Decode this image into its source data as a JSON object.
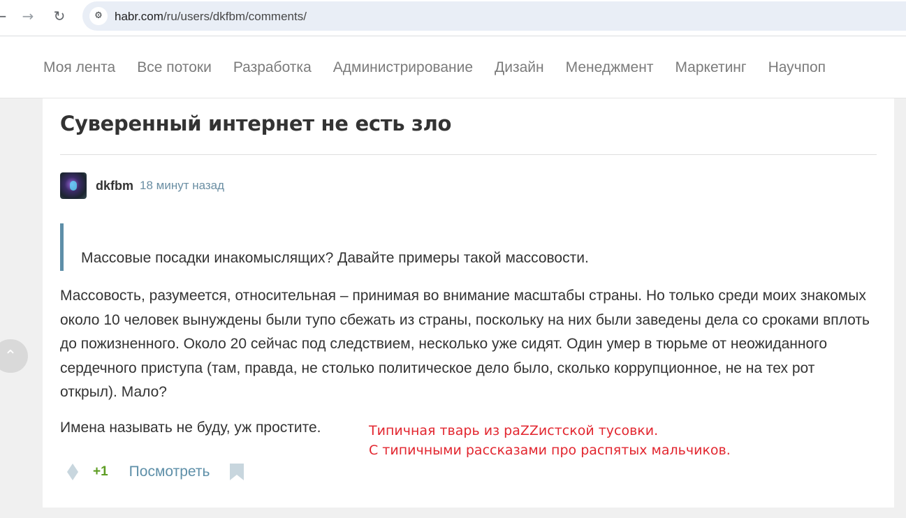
{
  "browser": {
    "back_icon": "arrow-left-icon",
    "forward_icon": "arrow-right-icon",
    "reload_icon": "reload-icon",
    "site_info_icon": "tune-icon",
    "url_host": "habr.com",
    "url_path": "/ru/users/dkfbm/comments/"
  },
  "nav": {
    "items": [
      "Моя лента",
      "Все потоки",
      "Разработка",
      "Администрирование",
      "Дизайн",
      "Менеджмент",
      "Маркетинг",
      "Научпоп"
    ]
  },
  "post": {
    "title": "Суверенный интернет не есть зло"
  },
  "comment": {
    "username": "dkfbm",
    "time": "18 минут назад",
    "quote": "Массовые посадки инакомыслящих? Давайте примеры такой массовости.",
    "paragraph1": "Массовость, разумеется, относительная – принимая во внимание масштабы страны. Но только среди моих знакомых около 10 человек вынуждены были тупо сбежать из страны, поскольку на них были заведены дела со сроками вплоть до пожизненного. Около 20 сейчас под следствием, несколько уже сидят. Один умер в тюрьме от неожиданного сердечного приступа (там, правда, не столько политическое дело было, сколько коррупционное, не на тех рот открыл). Мало?",
    "paragraph2": "Имена называть не буду, уж простите.",
    "score": "+1",
    "view_label": "Посмотреть"
  },
  "annotation": {
    "line1": "Типичная тварь из paZZистской тусовки.",
    "line2": "С типичными рассказами про распятых мальчиков.",
    "color": "#e2262f"
  },
  "colors": {
    "link": "#5e8fa8",
    "score": "#5d9d23",
    "text": "#333333"
  }
}
